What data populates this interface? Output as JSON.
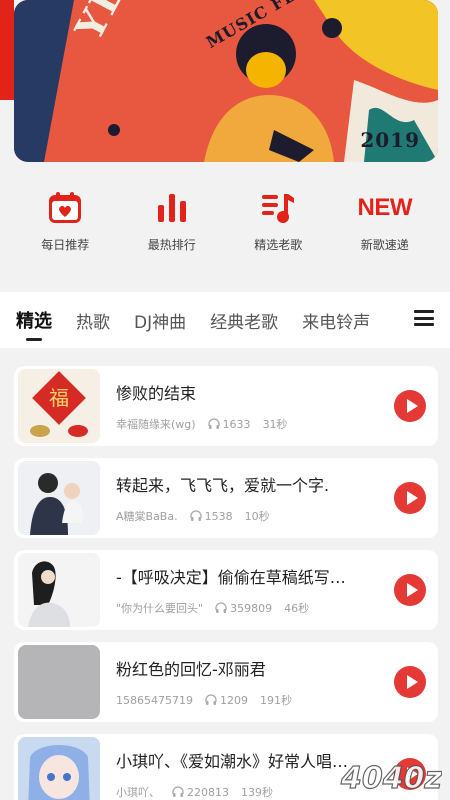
{
  "banner": {
    "art_title": "YEAH",
    "art_subtitle": "MUSIC FES",
    "year": "2019"
  },
  "quick_menu": [
    {
      "label": "每日推荐",
      "icon": "calendar-heart-icon"
    },
    {
      "label": "最热排行",
      "icon": "bar-chart-icon"
    },
    {
      "label": "精选老歌",
      "icon": "music-list-icon"
    },
    {
      "label": "新歌速递",
      "icon": "new-badge-icon",
      "icon_text": "NEW"
    }
  ],
  "tabs": [
    "精选",
    "热歌",
    "DJ神曲",
    "经典老歌",
    "来电铃声"
  ],
  "active_tab": 0,
  "songs": [
    {
      "title": "惨败的结束",
      "author": "幸福随缘来(wg)",
      "plays": "1633",
      "duration": "31秒"
    },
    {
      "title": "转起来，飞飞飞，爱就一个字.",
      "author": "A糖棠BaBa.",
      "plays": "1538",
      "duration": "10秒"
    },
    {
      "title": "-【呼吸决定】偷偷在草稿纸写…",
      "author": "\"你为什么要回头\"",
      "plays": "359809",
      "duration": "46秒"
    },
    {
      "title": "粉红色的回忆-邓丽君",
      "author": "15865475719",
      "plays": "1209",
      "duration": "191秒"
    },
    {
      "title": "小琪吖、《爱如潮水》好常人唱…",
      "author": "小琪吖、",
      "plays": "220813",
      "duration": "139秒"
    }
  ],
  "watermark": "4040z",
  "colors": {
    "accent": "#e2231a",
    "play_button": "#e53935"
  }
}
